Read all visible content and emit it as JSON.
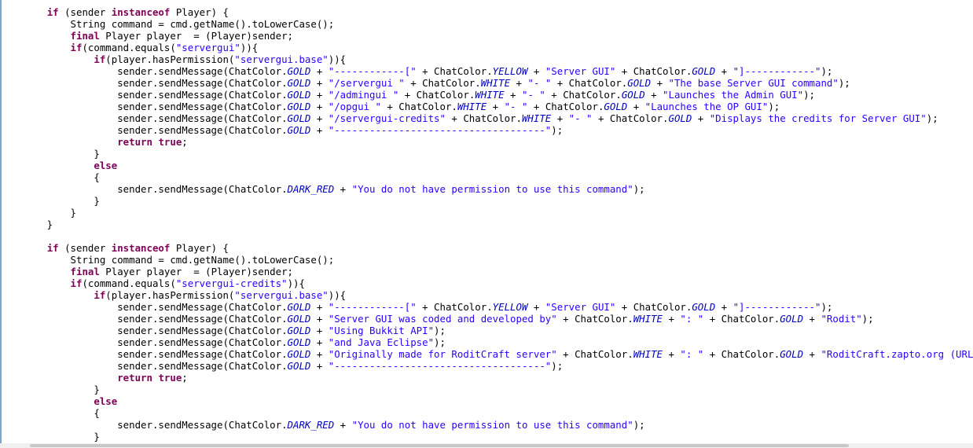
{
  "editor": {
    "lines": [
      [
        {
          "t": "p",
          "v": "       "
        },
        {
          "t": "p",
          "v": "                                                      "
        },
        {
          "t": "p",
          "v": "                                                                                                                          "
        }
      ],
      [
        {
          "t": "p",
          "v": "        "
        },
        {
          "t": "kw",
          "v": "if"
        },
        {
          "t": "p",
          "v": " (sender "
        },
        {
          "t": "kw",
          "v": "instanceof"
        },
        {
          "t": "p",
          "v": " Player) {"
        }
      ],
      [
        {
          "t": "p",
          "v": "            String command = cmd.getName().toLowerCase();"
        }
      ],
      [
        {
          "t": "p",
          "v": "            "
        },
        {
          "t": "kw",
          "v": "final"
        },
        {
          "t": "p",
          "v": " Player player  = (Player)sender;"
        }
      ],
      [
        {
          "t": "p",
          "v": "            "
        },
        {
          "t": "kw",
          "v": "if"
        },
        {
          "t": "p",
          "v": "(command.equals("
        },
        {
          "t": "str",
          "v": "\"servergui\""
        },
        {
          "t": "p",
          "v": ")){"
        }
      ],
      [
        {
          "t": "p",
          "v": "                "
        },
        {
          "t": "kw",
          "v": "if"
        },
        {
          "t": "p",
          "v": "(player.hasPermission("
        },
        {
          "t": "str",
          "v": "\"servergui.base\""
        },
        {
          "t": "p",
          "v": ")){"
        }
      ],
      [
        {
          "t": "p",
          "v": "                    sender.sendMessage(ChatColor."
        },
        {
          "t": "fld",
          "v": "GOLD"
        },
        {
          "t": "p",
          "v": " + "
        },
        {
          "t": "str",
          "v": "\"------------[\""
        },
        {
          "t": "p",
          "v": " + ChatColor."
        },
        {
          "t": "fld",
          "v": "YELLOW"
        },
        {
          "t": "p",
          "v": " + "
        },
        {
          "t": "str",
          "v": "\"Server GUI\""
        },
        {
          "t": "p",
          "v": " + ChatColor."
        },
        {
          "t": "fld",
          "v": "GOLD"
        },
        {
          "t": "p",
          "v": " + "
        },
        {
          "t": "str",
          "v": "\"]------------\""
        },
        {
          "t": "p",
          "v": ");"
        }
      ],
      [
        {
          "t": "p",
          "v": "                    sender.sendMessage(ChatColor."
        },
        {
          "t": "fld",
          "v": "GOLD"
        },
        {
          "t": "p",
          "v": " + "
        },
        {
          "t": "str",
          "v": "\"/servergui \""
        },
        {
          "t": "p",
          "v": " + ChatColor."
        },
        {
          "t": "fld",
          "v": "WHITE"
        },
        {
          "t": "p",
          "v": " + "
        },
        {
          "t": "str",
          "v": "\"- \""
        },
        {
          "t": "p",
          "v": " + ChatColor."
        },
        {
          "t": "fld",
          "v": "GOLD"
        },
        {
          "t": "p",
          "v": " + "
        },
        {
          "t": "str",
          "v": "\"The base Server GUI command\""
        },
        {
          "t": "p",
          "v": ");"
        }
      ],
      [
        {
          "t": "p",
          "v": "                    sender.sendMessage(ChatColor."
        },
        {
          "t": "fld",
          "v": "GOLD"
        },
        {
          "t": "p",
          "v": " + "
        },
        {
          "t": "str",
          "v": "\"/admingui \""
        },
        {
          "t": "p",
          "v": " + ChatColor."
        },
        {
          "t": "fld",
          "v": "WHITE"
        },
        {
          "t": "p",
          "v": " + "
        },
        {
          "t": "str",
          "v": "\"- \""
        },
        {
          "t": "p",
          "v": " + ChatColor."
        },
        {
          "t": "fld",
          "v": "GOLD"
        },
        {
          "t": "p",
          "v": " + "
        },
        {
          "t": "str",
          "v": "\"Launches the Admin GUI\""
        },
        {
          "t": "p",
          "v": ");"
        }
      ],
      [
        {
          "t": "p",
          "v": "                    sender.sendMessage(ChatColor."
        },
        {
          "t": "fld",
          "v": "GOLD"
        },
        {
          "t": "p",
          "v": " + "
        },
        {
          "t": "str",
          "v": "\"/opgui \""
        },
        {
          "t": "p",
          "v": " + ChatColor."
        },
        {
          "t": "fld",
          "v": "WHITE"
        },
        {
          "t": "p",
          "v": " + "
        },
        {
          "t": "str",
          "v": "\"- \""
        },
        {
          "t": "p",
          "v": " + ChatColor."
        },
        {
          "t": "fld",
          "v": "GOLD"
        },
        {
          "t": "p",
          "v": " + "
        },
        {
          "t": "str",
          "v": "\"Launches the OP GUI\""
        },
        {
          "t": "p",
          "v": ");"
        }
      ],
      [
        {
          "t": "p",
          "v": "                    sender.sendMessage(ChatColor."
        },
        {
          "t": "fld",
          "v": "GOLD"
        },
        {
          "t": "p",
          "v": " + "
        },
        {
          "t": "str",
          "v": "\"/servergui-credits\""
        },
        {
          "t": "p",
          "v": " + ChatColor."
        },
        {
          "t": "fld",
          "v": "WHITE"
        },
        {
          "t": "p",
          "v": " + "
        },
        {
          "t": "str",
          "v": "\"- \""
        },
        {
          "t": "p",
          "v": " + ChatColor."
        },
        {
          "t": "fld",
          "v": "GOLD"
        },
        {
          "t": "p",
          "v": " + "
        },
        {
          "t": "str",
          "v": "\"Displays the credits for Server GUI\""
        },
        {
          "t": "p",
          "v": ");"
        }
      ],
      [
        {
          "t": "p",
          "v": "                    sender.sendMessage(ChatColor."
        },
        {
          "t": "fld",
          "v": "GOLD"
        },
        {
          "t": "p",
          "v": " + "
        },
        {
          "t": "str",
          "v": "\"------------------------------------\""
        },
        {
          "t": "p",
          "v": ");"
        }
      ],
      [
        {
          "t": "p",
          "v": "                    "
        },
        {
          "t": "kw",
          "v": "return"
        },
        {
          "t": "p",
          "v": " "
        },
        {
          "t": "kw",
          "v": "true"
        },
        {
          "t": "p",
          "v": ";"
        }
      ],
      [
        {
          "t": "p",
          "v": "                }"
        }
      ],
      [
        {
          "t": "p",
          "v": "                "
        },
        {
          "t": "kw",
          "v": "else"
        }
      ],
      [
        {
          "t": "p",
          "v": "                {"
        }
      ],
      [
        {
          "t": "p",
          "v": "                    sender.sendMessage(ChatColor."
        },
        {
          "t": "fld",
          "v": "DARK_RED"
        },
        {
          "t": "p",
          "v": " + "
        },
        {
          "t": "str",
          "v": "\"You do not have permission to use this command\""
        },
        {
          "t": "p",
          "v": ");"
        }
      ],
      [
        {
          "t": "p",
          "v": "                }"
        }
      ],
      [
        {
          "t": "p",
          "v": "            }"
        }
      ],
      [
        {
          "t": "p",
          "v": "        }"
        }
      ],
      [
        {
          "t": "p",
          "v": ""
        }
      ],
      [
        {
          "t": "p",
          "v": "        "
        },
        {
          "t": "kw",
          "v": "if"
        },
        {
          "t": "p",
          "v": " (sender "
        },
        {
          "t": "kw",
          "v": "instanceof"
        },
        {
          "t": "p",
          "v": " Player) {"
        }
      ],
      [
        {
          "t": "p",
          "v": "            String command = cmd.getName().toLowerCase();"
        }
      ],
      [
        {
          "t": "p",
          "v": "            "
        },
        {
          "t": "kw",
          "v": "final"
        },
        {
          "t": "p",
          "v": " Player player  = (Player)sender;"
        }
      ],
      [
        {
          "t": "p",
          "v": "            "
        },
        {
          "t": "kw",
          "v": "if"
        },
        {
          "t": "p",
          "v": "(command.equals("
        },
        {
          "t": "str",
          "v": "\"servergui-credits\""
        },
        {
          "t": "p",
          "v": ")){"
        }
      ],
      [
        {
          "t": "p",
          "v": "                "
        },
        {
          "t": "kw",
          "v": "if"
        },
        {
          "t": "p",
          "v": "(player.hasPermission("
        },
        {
          "t": "str",
          "v": "\"servergui.base\""
        },
        {
          "t": "p",
          "v": ")){"
        }
      ],
      [
        {
          "t": "p",
          "v": "                    sender.sendMessage(ChatColor."
        },
        {
          "t": "fld",
          "v": "GOLD"
        },
        {
          "t": "p",
          "v": " + "
        },
        {
          "t": "str",
          "v": "\"------------[\""
        },
        {
          "t": "p",
          "v": " + ChatColor."
        },
        {
          "t": "fld",
          "v": "YELLOW"
        },
        {
          "t": "p",
          "v": " + "
        },
        {
          "t": "str",
          "v": "\"Server GUI\""
        },
        {
          "t": "p",
          "v": " + ChatColor."
        },
        {
          "t": "fld",
          "v": "GOLD"
        },
        {
          "t": "p",
          "v": " + "
        },
        {
          "t": "str",
          "v": "\"]------------\""
        },
        {
          "t": "p",
          "v": ");"
        }
      ],
      [
        {
          "t": "p",
          "v": "                    sender.sendMessage(ChatColor."
        },
        {
          "t": "fld",
          "v": "GOLD"
        },
        {
          "t": "p",
          "v": " + "
        },
        {
          "t": "str",
          "v": "\"Server GUI was coded and developed by\""
        },
        {
          "t": "p",
          "v": " + ChatColor."
        },
        {
          "t": "fld",
          "v": "WHITE"
        },
        {
          "t": "p",
          "v": " + "
        },
        {
          "t": "str",
          "v": "\": \""
        },
        {
          "t": "p",
          "v": " + ChatColor."
        },
        {
          "t": "fld",
          "v": "GOLD"
        },
        {
          "t": "p",
          "v": " + "
        },
        {
          "t": "str",
          "v": "\"Rodit\""
        },
        {
          "t": "p",
          "v": ");"
        }
      ],
      [
        {
          "t": "p",
          "v": "                    sender.sendMessage(ChatColor."
        },
        {
          "t": "fld",
          "v": "GOLD"
        },
        {
          "t": "p",
          "v": " + "
        },
        {
          "t": "str",
          "v": "\"Using Bukkit API\""
        },
        {
          "t": "p",
          "v": ");"
        }
      ],
      [
        {
          "t": "p",
          "v": "                    sender.sendMessage(ChatColor."
        },
        {
          "t": "fld",
          "v": "GOLD"
        },
        {
          "t": "p",
          "v": " + "
        },
        {
          "t": "str",
          "v": "\"and Java Eclipse\""
        },
        {
          "t": "p",
          "v": ");"
        }
      ],
      [
        {
          "t": "p",
          "v": "                    sender.sendMessage(ChatColor."
        },
        {
          "t": "fld",
          "v": "GOLD"
        },
        {
          "t": "p",
          "v": " + "
        },
        {
          "t": "str",
          "v": "\"Originally made for RoditCraft server\""
        },
        {
          "t": "p",
          "v": " + ChatColor."
        },
        {
          "t": "fld",
          "v": "WHITE"
        },
        {
          "t": "p",
          "v": " + "
        },
        {
          "t": "str",
          "v": "\": \""
        },
        {
          "t": "p",
          "v": " + ChatColor."
        },
        {
          "t": "fld",
          "v": "GOLD"
        },
        {
          "t": "p",
          "v": " + "
        },
        {
          "t": "str",
          "v": "\"RoditCraft.zapto.org (URL for web"
        }
      ],
      [
        {
          "t": "p",
          "v": "                    sender.sendMessage(ChatColor."
        },
        {
          "t": "fld",
          "v": "GOLD"
        },
        {
          "t": "p",
          "v": " + "
        },
        {
          "t": "str",
          "v": "\"------------------------------------\""
        },
        {
          "t": "p",
          "v": ");"
        }
      ],
      [
        {
          "t": "p",
          "v": "                    "
        },
        {
          "t": "kw",
          "v": "return"
        },
        {
          "t": "p",
          "v": " "
        },
        {
          "t": "kw",
          "v": "true"
        },
        {
          "t": "p",
          "v": ";"
        }
      ],
      [
        {
          "t": "p",
          "v": "                }"
        }
      ],
      [
        {
          "t": "p",
          "v": "                "
        },
        {
          "t": "kw",
          "v": "else"
        }
      ],
      [
        {
          "t": "p",
          "v": "                {"
        }
      ],
      [
        {
          "t": "p",
          "v": "                    sender.sendMessage(ChatColor."
        },
        {
          "t": "fld",
          "v": "DARK_RED"
        },
        {
          "t": "p",
          "v": " + "
        },
        {
          "t": "str",
          "v": "\"You do not have permission to use this command\""
        },
        {
          "t": "p",
          "v": ");"
        }
      ],
      [
        {
          "t": "p",
          "v": "                }"
        }
      ],
      [
        {
          "t": "p",
          "v": "            }"
        }
      ]
    ]
  },
  "colors": {
    "keyword": "#7f0055",
    "string": "#2a00ff",
    "field": "#0000c0",
    "text": "#000000",
    "background": "#ffffff"
  }
}
